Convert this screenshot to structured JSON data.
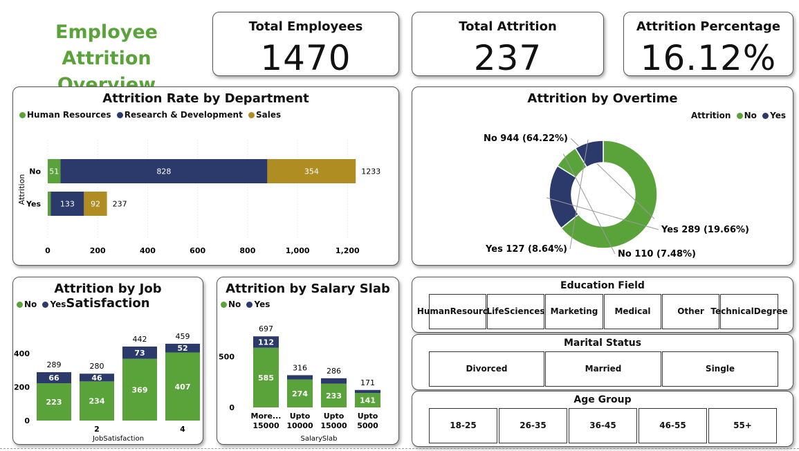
{
  "title": "Employee Attrition Overview",
  "kpis": [
    {
      "label": "Total Employees",
      "value": "1470"
    },
    {
      "label": "Total Attrition",
      "value": "237"
    },
    {
      "label": "Attrition Percentage",
      "value": "16.12%"
    }
  ],
  "colors": {
    "green": "#5aa33b",
    "navy": "#2b3a6b",
    "gold": "#b08d22"
  },
  "dept_chart": {
    "title": "Attrition Rate by Department",
    "legend": [
      "Human Resources",
      "Research & Development",
      "Sales"
    ],
    "ylabel": "Attrition",
    "chart_data": {
      "type": "bar",
      "orientation": "horizontal",
      "stacked": true,
      "categories": [
        "No",
        "Yes"
      ],
      "series": [
        {
          "name": "Human Resources",
          "values": [
            51,
            12
          ]
        },
        {
          "name": "Research & Development",
          "values": [
            828,
            133
          ]
        },
        {
          "name": "Sales",
          "values": [
            354,
            92
          ]
        }
      ],
      "totals": [
        "1233",
        "237"
      ],
      "data_labels": [
        [
          "51",
          "828",
          "354"
        ],
        [
          "",
          "133",
          "92"
        ]
      ],
      "ticks": [
        "0",
        "200",
        "400",
        "600",
        "800",
        "1,000",
        "1,200"
      ],
      "tick_values": [
        0,
        200,
        400,
        600,
        800,
        1000,
        1200
      ],
      "xlim": [
        0,
        1260
      ]
    }
  },
  "overtime_chart": {
    "title": "Attrition by Overtime",
    "legend_title": "Attrition",
    "legend": [
      "No",
      "Yes"
    ],
    "chart_data": {
      "type": "pie",
      "donut": true,
      "slices": [
        {
          "label": "No 944 (64.22%)",
          "value": 944,
          "series": "No"
        },
        {
          "label": "Yes 289 (19.66%)",
          "value": 289,
          "series": "Yes"
        },
        {
          "label": "No 110 (7.48%)",
          "value": 110,
          "series": "No"
        },
        {
          "label": "Yes 127 (8.64%)",
          "value": 127,
          "series": "Yes"
        }
      ]
    }
  },
  "jobsat_chart": {
    "title": "Attrition by Job Satisfaction",
    "legend": [
      "No",
      "Yes"
    ],
    "xlabel": "JobSatisfaction",
    "chart_data": {
      "type": "bar",
      "stacked": true,
      "categories": [
        "",
        "2",
        "",
        "4"
      ],
      "series": [
        {
          "name": "No",
          "values": [
            223,
            234,
            369,
            407
          ]
        },
        {
          "name": "Yes",
          "values": [
            66,
            46,
            73,
            52
          ]
        }
      ],
      "totals": [
        "289",
        "280",
        "442",
        "459"
      ],
      "ticks": [
        "0",
        "200",
        "400"
      ],
      "tick_values": [
        0,
        200,
        400
      ],
      "ylim": [
        0,
        500
      ]
    }
  },
  "salary_chart": {
    "title": "Attrition by Salary Slab",
    "legend": [
      "No",
      "Yes"
    ],
    "xlabel": "SalarySlab",
    "chart_data": {
      "type": "bar",
      "stacked": true,
      "categories": [
        [
          "More...",
          "15000"
        ],
        [
          "Upto",
          "10000"
        ],
        [
          "Upto",
          "15000"
        ],
        [
          "Upto",
          "5000"
        ]
      ],
      "series": [
        {
          "name": "No",
          "values": [
            585,
            274,
            233,
            141
          ]
        },
        {
          "name": "Yes",
          "values": [
            112,
            42,
            53,
            30
          ]
        }
      ],
      "data_labels": [
        [
          "585",
          "274",
          "233",
          "141"
        ],
        [
          "112",
          "",
          "",
          ""
        ]
      ],
      "totals": [
        "697",
        "316",
        "286",
        "171"
      ],
      "ticks": [
        "0",
        "500"
      ],
      "tick_values": [
        0,
        500
      ],
      "ylim": [
        0,
        780
      ]
    }
  },
  "slicers": {
    "education": {
      "title": "Education Field",
      "options": [
        [
          "Human",
          "Resources"
        ],
        [
          "Life",
          "Sciences"
        ],
        [
          "Marketing"
        ],
        [
          "Medical"
        ],
        [
          "Other"
        ],
        [
          "Technical",
          "Degree"
        ]
      ]
    },
    "marital": {
      "title": "Marital Status",
      "options": [
        "Divorced",
        "Married",
        "Single"
      ]
    },
    "age": {
      "title": "Age Group",
      "options": [
        "18-25",
        "26-35",
        "36-45",
        "46-55",
        "55+"
      ]
    }
  }
}
